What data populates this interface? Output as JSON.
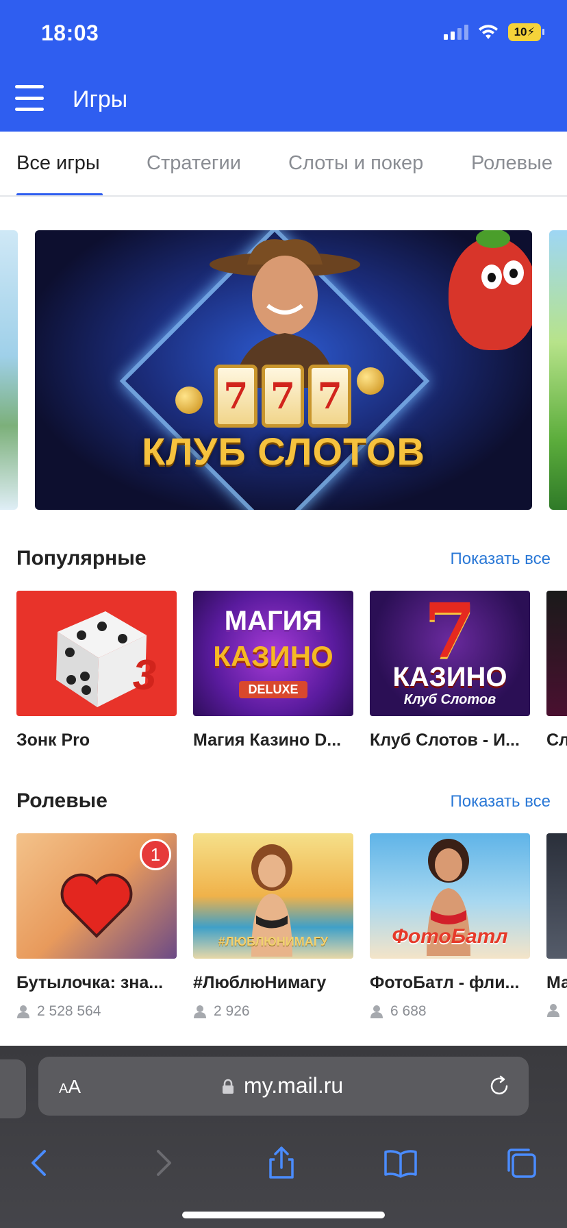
{
  "status": {
    "time": "18:03",
    "battery": "10"
  },
  "header": {
    "title": "Игры"
  },
  "tabs": [
    "Все игры",
    "Стратегии",
    "Слоты и покер",
    "Ролевые"
  ],
  "banner": {
    "text": "КЛУБ СЛОТОВ",
    "reels": [
      "7",
      "7",
      "7"
    ]
  },
  "popular": {
    "title": "Популярные",
    "show_all": "Показать все",
    "items": [
      {
        "title": "Зонк Pro",
        "thumb_text": "3"
      },
      {
        "title": "Магия Казино D...",
        "thumb_text": "МАГИЯ",
        "thumb_text2": "КАЗИНО",
        "thumb_text3": "DELUXE"
      },
      {
        "title": "Клуб Слотов - И...",
        "thumb_text": "КАЗИНО",
        "thumb_text2": "Клуб Слотов"
      },
      {
        "title": "Сл"
      }
    ]
  },
  "roleplay": {
    "title": "Ролевые",
    "show_all": "Показать все",
    "items": [
      {
        "title": "Бутылочка: зна...",
        "players": "2 528 564",
        "badge": "1"
      },
      {
        "title": "#ЛюблюНимагу",
        "players": "2 926",
        "thumb_text": "#ЛЮБЛЮНИМАГУ"
      },
      {
        "title": "ФотоБатл - фли...",
        "players": "6 688",
        "thumb_text": "ФотоБатл"
      },
      {
        "title": "Ма"
      }
    ]
  },
  "browser": {
    "aa_small": "A",
    "aa_large": "A",
    "url": "my.mail.ru"
  },
  "colors": {
    "header": "#2f5ef0",
    "link": "#2a78d6",
    "badge": "#e63a3a"
  }
}
